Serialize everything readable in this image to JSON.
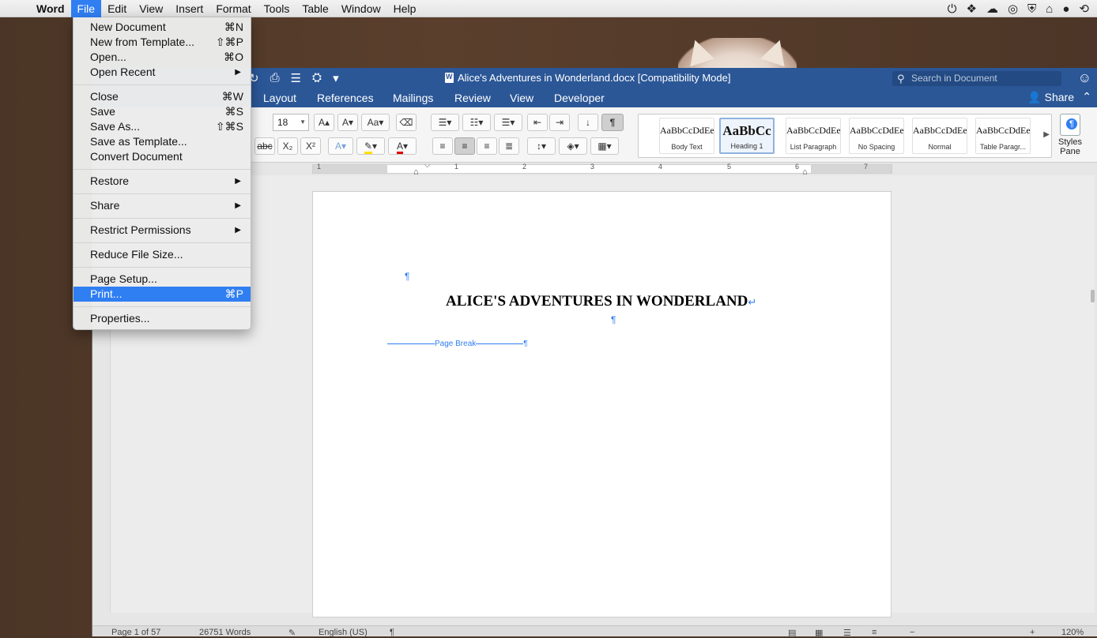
{
  "menubar": {
    "app": "Word",
    "items": [
      "File",
      "Edit",
      "View",
      "Insert",
      "Format",
      "Tools",
      "Table",
      "Window",
      "Help"
    ]
  },
  "file_menu": {
    "groups": [
      [
        {
          "label": "New Document",
          "shortcut": "⌘N"
        },
        {
          "label": "New from Template...",
          "shortcut": "⇧⌘P"
        },
        {
          "label": "Open...",
          "shortcut": "⌘O"
        },
        {
          "label": "Open Recent",
          "submenu": true
        }
      ],
      [
        {
          "label": "Close",
          "shortcut": "⌘W"
        },
        {
          "label": "Save",
          "shortcut": "⌘S"
        },
        {
          "label": "Save As...",
          "shortcut": "⇧⌘S"
        },
        {
          "label": "Save as Template..."
        },
        {
          "label": "Convert Document"
        }
      ],
      [
        {
          "label": "Restore",
          "submenu": true
        }
      ],
      [
        {
          "label": "Share",
          "submenu": true
        }
      ],
      [
        {
          "label": "Restrict Permissions",
          "submenu": true
        }
      ],
      [
        {
          "label": "Reduce File Size..."
        }
      ],
      [
        {
          "label": "Page Setup..."
        },
        {
          "label": "Print...",
          "shortcut": "⌘P",
          "highlighted": true
        }
      ],
      [
        {
          "label": "Properties..."
        }
      ]
    ]
  },
  "window": {
    "title": "Alice's Adventures in Wonderland.docx [Compatibility Mode]",
    "search_placeholder": "Search in Document",
    "tabs": [
      "Layout",
      "References",
      "Mailings",
      "Review",
      "View",
      "Developer"
    ],
    "share_label": "Share"
  },
  "ribbon": {
    "font_size": "18",
    "styles": [
      {
        "sample": "AaBbCcDdEe",
        "name": "Body Text"
      },
      {
        "sample": "AaBbCc",
        "name": "Heading 1",
        "selected": true
      },
      {
        "sample": "AaBbCcDdEe",
        "name": "List Paragraph"
      },
      {
        "sample": "AaBbCcDdEe",
        "name": "No Spacing"
      },
      {
        "sample": "AaBbCcDdEe",
        "name": "Normal"
      },
      {
        "sample": "AaBbCcDdEe",
        "name": "Table Paragr..."
      }
    ],
    "styles_pane_label": "Styles Pane"
  },
  "ruler": {
    "numbers": [
      "1",
      "1",
      "2",
      "3",
      "4",
      "5",
      "6",
      "7"
    ]
  },
  "document": {
    "pilcrow": "¶",
    "title": "ALICE'S ADVENTURES IN WONDERLAND",
    "return_mark": "↵",
    "page_break_label": "Page Break"
  },
  "status": {
    "page": "Page 1 of 57",
    "words": "26751 Words",
    "language": "English (US)",
    "zoom": "120%"
  },
  "colors": {
    "accent": "#2f7ef2",
    "title_bar": "#2b5797"
  }
}
